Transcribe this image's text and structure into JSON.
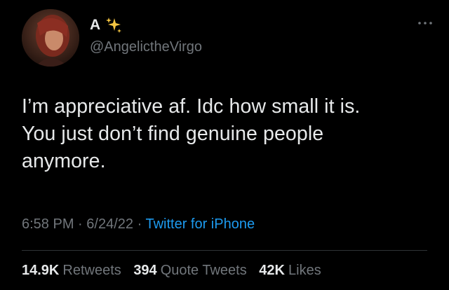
{
  "author": {
    "display_name": "A",
    "handle": "@AngelictheVirgo",
    "emoji_icon": "sparkles-icon"
  },
  "tweet": {
    "text": "I’m appreciative af. Idc how small it is.\nYou just don’t find genuine people\nanymore."
  },
  "meta": {
    "time": "6:58 PM",
    "separator": "·",
    "date": "6/24/22",
    "source": "Twitter for iPhone"
  },
  "stats": {
    "retweets_count": "14.9K",
    "retweets_label": "Retweets",
    "quote_count": "394",
    "quote_label": "Quote Tweets",
    "likes_count": "42K",
    "likes_label": "Likes"
  },
  "colors": {
    "background": "#000000",
    "text_primary": "#e7e9ea",
    "text_secondary": "#71767b",
    "link": "#1d9bf0",
    "divider": "#2f3336",
    "sparkle": "#f5c542"
  }
}
